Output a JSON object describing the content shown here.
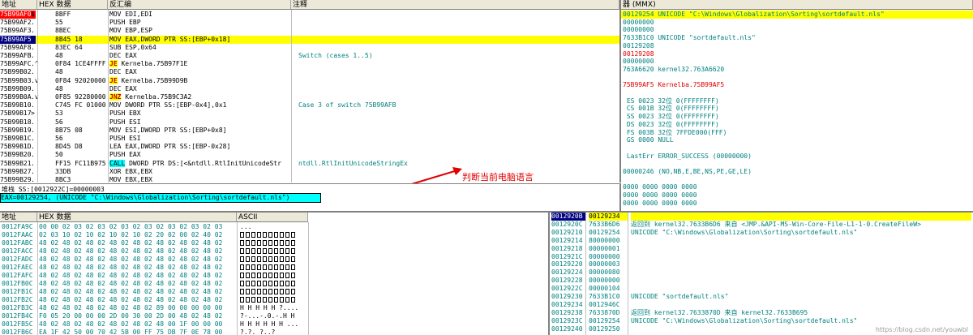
{
  "colors": {
    "accent_yellow": "#ffff00",
    "breakpoint_red": "#ff0000",
    "teal": "#008080",
    "annotation_red": "#e00000",
    "cyan": "#00ffff",
    "navy": "#000080"
  },
  "cpu": {
    "headers": {
      "addr": "地址",
      "hex": "HEX 数据",
      "asm": "反汇编",
      "comment": "注释"
    },
    "rows": [
      {
        "addr": "75B99AF0",
        "marker": "$",
        "hex": "8BFF",
        "asm": "MOV EDI,EDI",
        "comment": ""
      },
      {
        "addr": "75B99AF2",
        "marker": ".",
        "hex": "55",
        "asm": "PUSH EBP",
        "comment": ""
      },
      {
        "addr": "75B99AF3",
        "marker": ".",
        "hex": "8BEC",
        "asm": "MOV EBP,ESP",
        "comment": ""
      },
      {
        "addr": "75B99AF5",
        "marker": ".",
        "hex": "8B45 18",
        "asm": "MOV EAX,DWORD PTR SS:[EBP+0x18]",
        "comment": ""
      },
      {
        "addr": "75B99AF8",
        "marker": ".",
        "hex": "83EC 64",
        "asm": "SUB ESP,0x64",
        "comment": ""
      },
      {
        "addr": "75B99AFB",
        "marker": ".",
        "hex": "48",
        "asm": "DEC EAX",
        "comment": "Switch (cases 1..5)"
      },
      {
        "addr": "75B99AFC",
        "marker": ".^",
        "hex": "0F84 1CE4FFFF",
        "asm_kw": "JE",
        "asm": "Kernelba.75B97F1E",
        "comment": ""
      },
      {
        "addr": "75B99B02",
        "marker": ".",
        "hex": "48",
        "asm": "DEC EAX",
        "comment": ""
      },
      {
        "addr": "75B99B03",
        "marker": ".v",
        "hex": "0F84 92020000",
        "asm_kw": "JE",
        "asm": "Kernelba.75B99D9B",
        "comment": ""
      },
      {
        "addr": "75B99B09",
        "marker": ".",
        "hex": "48",
        "asm": "DEC EAX",
        "comment": ""
      },
      {
        "addr": "75B99B0A",
        "marker": ".v",
        "hex": "0F85 92280000",
        "asm_kw": "JNZ",
        "asm": "Kernelba.75B9C3A2",
        "comment": ""
      },
      {
        "addr": "75B99B10",
        "marker": ".",
        "hex": "C745 FC 01000",
        "asm": "MOV DWORD PTR SS:[EBP-0x4],0x1",
        "comment": "Case 3 of switch 75B99AFB"
      },
      {
        "addr": "75B99B17",
        "marker": ">",
        "hex": "53",
        "asm": "PUSH EBX",
        "comment": ""
      },
      {
        "addr": "75B99B18",
        "marker": ".",
        "hex": "56",
        "asm": "PUSH ESI",
        "comment": ""
      },
      {
        "addr": "75B99B19",
        "marker": ".",
        "hex": "8B75 08",
        "asm": "MOV ESI,DWORD PTR SS:[EBP+0x8]",
        "comment": ""
      },
      {
        "addr": "75B99B1C",
        "marker": ".",
        "hex": "56",
        "asm": "PUSH ESI",
        "comment": ""
      },
      {
        "addr": "75B99B1D",
        "marker": ".",
        "hex": "8D45 D8",
        "asm": "LEA EAX,DWORD PTR SS:[EBP-0x28]",
        "comment": ""
      },
      {
        "addr": "75B99B20",
        "marker": ".",
        "hex": "50",
        "asm": "PUSH EAX",
        "comment": ""
      },
      {
        "addr": "75B99B21",
        "marker": ".",
        "hex": "FF15 FC11B975",
        "asm_kw": "CALL",
        "asm": "DWORD PTR DS:[<&ntdll.RtlInitUnicodeStr",
        "comment": "ntdll.RtlInitUnicodeStringEx"
      },
      {
        "addr": "75B99B27",
        "marker": ".",
        "hex": "33DB",
        "asm": "XOR EBX,EBX",
        "comment": ""
      },
      {
        "addr": "75B99B29",
        "marker": ".",
        "hex": "8BC3",
        "asm": "MOV EBX,EBX",
        "comment": ""
      }
    ],
    "info_line1": "堆栈 SS:[0012922C]=00000003",
    "info_line2": "EAX=00129254, (UNICODE \"C:\\Windows\\Globalization\\Sorting\\sortdefault.nls\")",
    "annotation": "判断当前电脑语言"
  },
  "registers": {
    "header": "器 (MMX)",
    "lines": [
      {
        "t": "00129254 UNICODE \"C:\\Windows\\Globalization\\Sorting\\sortdefault.nls\"",
        "hl": true
      },
      {
        "t": "00000000"
      },
      {
        "t": "00000000"
      },
      {
        "t": "7633B1C0 UNICODE \"sortdefault.nls\""
      },
      {
        "t": "00129208"
      },
      {
        "t": "00129208",
        "red": true
      },
      {
        "t": "00000000"
      },
      {
        "t": "763A6620 kernel32.763A6620"
      },
      {
        "t": ""
      },
      {
        "t": "75B99AF5 Kernelba.75B99AF5",
        "red": true
      },
      {
        "t": ""
      },
      {
        "t": " ES 0023 32位 0(FFFFFFFF)"
      },
      {
        "t": " CS 001B 32位 0(FFFFFFFF)"
      },
      {
        "t": " SS 0023 32位 0(FFFFFFFF)"
      },
      {
        "t": " DS 0023 32位 0(FFFFFFFF)"
      },
      {
        "t": " FS 003B 32位 7FFDE000(FFF)"
      },
      {
        "t": " GS 0000 NULL"
      },
      {
        "t": ""
      },
      {
        "t": " LastErr ERROR_SUCCESS (00000000)"
      },
      {
        "t": ""
      },
      {
        "t": "00000246 (NO,NB,E,BE,NS,PE,GE,LE)"
      },
      {
        "t": ""
      },
      {
        "t": "0000 0000 0000 0000"
      },
      {
        "t": "0000 0000 0000 0000"
      },
      {
        "t": "0000 0000 0000 0000"
      }
    ]
  },
  "dump": {
    "headers": {
      "addr": "地址",
      "hex": "HEX 数据",
      "ascii": "ASCII"
    },
    "rows": [
      {
        "addr": "0012FA9C",
        "hex": "00 00 02 03 02 03 02 03 02 03 02 03 02 03 02 03",
        "ascii": "..."
      },
      {
        "addr": "0012FAAC",
        "hex": "02 03 10 02 10 02 10 02 10 02 20 02 00 02 40 02",
        "ascii": "boxes"
      },
      {
        "addr": "0012FABC",
        "hex": "48 02 48 02 48 02 48 02 48 02 48 02 48 02 48 02",
        "ascii": "boxes"
      },
      {
        "addr": "0012FACC",
        "hex": "48 02 48 02 48 02 48 02 48 02 48 02 48 02 48 02",
        "ascii": "boxes"
      },
      {
        "addr": "0012FADC",
        "hex": "48 02 48 02 48 02 48 02 48 02 48 02 48 02 48 02",
        "ascii": "boxes"
      },
      {
        "addr": "0012FAEC",
        "hex": "48 02 48 02 48 02 48 02 48 02 48 02 48 02 48 02",
        "ascii": "boxes"
      },
      {
        "addr": "0012FAFC",
        "hex": "48 02 48 02 48 02 48 02 48 02 48 02 48 02 48 02",
        "ascii": "boxes"
      },
      {
        "addr": "0012FB0C",
        "hex": "48 02 48 02 48 02 48 02 48 02 48 02 48 02 48 02",
        "ascii": "boxes"
      },
      {
        "addr": "0012FB1C",
        "hex": "48 02 48 02 48 02 48 02 48 02 48 02 48 02 48 02",
        "ascii": "boxes"
      },
      {
        "addr": "0012FB2C",
        "hex": "48 02 48 02 48 02 48 02 48 02 48 02 48 02 48 02",
        "ascii": "boxes"
      },
      {
        "addr": "0012FB3C",
        "hex": "48 02 48 02 48 02 48 02 48 02 89 00 00 00 00 00",
        "ascii": "H H H H H ?...."
      },
      {
        "addr": "0012FB4C",
        "hex": "F0 05 20 00 00 00 2D 00 30 00 2D 00 48 02 48 02",
        "ascii": "?-...-.0.-.H H"
      },
      {
        "addr": "0012FB5C",
        "hex": "48 02 48 02 48 02 48 02 48 02 48 00 1F 00 00 00",
        "ascii": "H H H H H H ..."
      },
      {
        "addr": "0012FB6C",
        "hex": "EA 1F 42 50 00 70 42 5B 00 FF 75 DB 7F 0E 78 00",
        "ascii": "?.?. ?..?"
      }
    ]
  },
  "stack": {
    "rows": [
      {
        "addr": "0012920B",
        "val": "00129234",
        "note": "",
        "sel": true
      },
      {
        "addr": "0012920C",
        "val": "7633B6D6",
        "note": "返回到 kernel32.7633B6D6 来自 <JMP.&API-MS-Win-Core-File-L1-1-0.CreateFileW>"
      },
      {
        "addr": "00129210",
        "val": "00129254",
        "note": "UNICODE \"C:\\Windows\\Globalization\\Sorting\\sortdefault.nls\""
      },
      {
        "addr": "00129214",
        "val": "80000000",
        "note": ""
      },
      {
        "addr": "00129218",
        "val": "00000001",
        "note": ""
      },
      {
        "addr": "0012921C",
        "val": "00000000",
        "note": ""
      },
      {
        "addr": "00129220",
        "val": "00000003",
        "note": ""
      },
      {
        "addr": "00129224",
        "val": "00000080",
        "note": ""
      },
      {
        "addr": "00129228",
        "val": "00000000",
        "note": ""
      },
      {
        "addr": "0012922C",
        "val": "00000104",
        "note": ""
      },
      {
        "addr": "00129230",
        "val": "7633B1C0",
        "note": "UNICODE \"sortdefault.nls\""
      },
      {
        "addr": "00129234",
        "val": "0012946C",
        "note": ""
      },
      {
        "addr": "00129238",
        "val": "7633870D",
        "note": "返回到 kernel32.7633870D 来自 kernel32.7633B695"
      },
      {
        "addr": "0012923C",
        "val": "00129254",
        "note": "UNICODE \"C:\\Windows\\Globalization\\Sorting\\sortdefault.nls\""
      },
      {
        "addr": "00129240",
        "val": "00129250",
        "note": ""
      }
    ]
  },
  "watermark": "https://blog.csdn.net/youwbl"
}
